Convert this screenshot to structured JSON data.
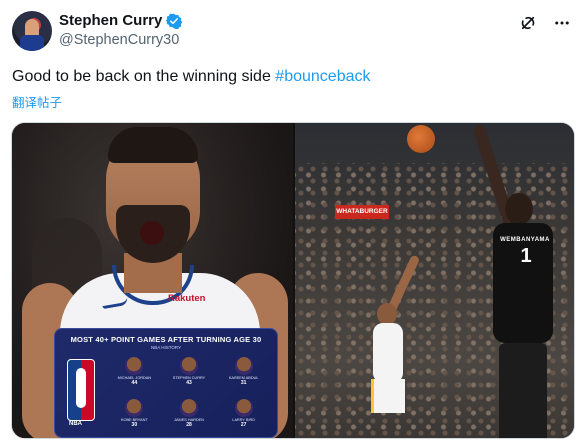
{
  "author": {
    "display_name": "Stephen Curry",
    "handle": "@StephenCurry30",
    "verified_color": "#1d9bf0"
  },
  "tweet": {
    "text": "Good to be back on the winning side ",
    "hashtag": "#bounceback",
    "translate_label": "翻译帖子"
  },
  "icons": {
    "grok": "grok-icon",
    "more": "more-icon"
  },
  "media": {
    "left_photo": {
      "sponsor": "Rakuten",
      "card": {
        "title": "MOST 40+ POINT GAMES AFTER TURNING AGE 30",
        "subtitle": "NBA HISTORY",
        "logo_text": "NBA",
        "players": [
          {
            "name": "MICHAEL JORDAN",
            "value": "44"
          },
          {
            "name": "STEPHEN CURRY",
            "value": "43"
          },
          {
            "name": "KAREEM ABDUL",
            "value": "31"
          },
          {
            "name": "KOBE BRYANT",
            "value": "30"
          },
          {
            "name": "JAMES HARDEN",
            "value": "28"
          },
          {
            "name": "LARRY BIRD",
            "value": "27"
          }
        ]
      }
    },
    "right_photo": {
      "sign_text": "WHATABURGER",
      "jersey_name": "WEMBANYAMA",
      "jersey_number": "1"
    }
  }
}
